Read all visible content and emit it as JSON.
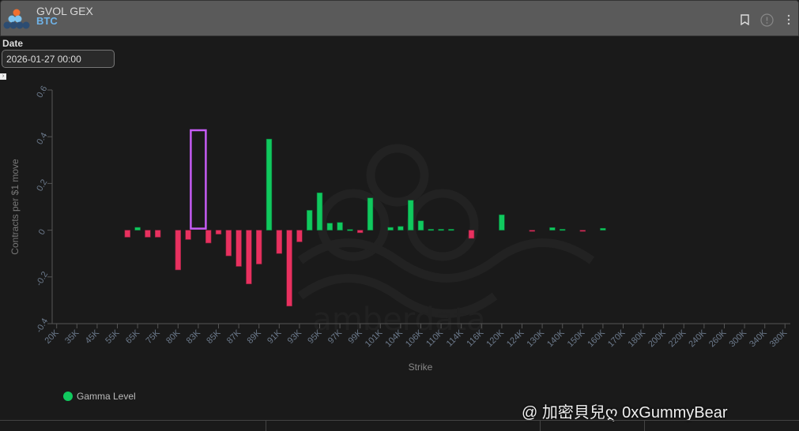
{
  "header": {
    "title": "GVOL GEX",
    "subtitle": "BTC",
    "icons": [
      "bookmark-icon",
      "info-icon",
      "more-vertical-icon"
    ]
  },
  "date_filter": {
    "label": "Date",
    "value": "2026-01-27 00:00"
  },
  "watermark": "amberdata",
  "overlay_text": "@ 加密貝兒ღ 0xGummyBear",
  "colors": {
    "positive": "#10c95e",
    "negative": "#e8315f",
    "highlight": "#c65cf5"
  },
  "chart_data": {
    "type": "bar",
    "xlabel": "Strike",
    "ylabel": "Contracts per $1 move",
    "ylim": [
      -0.4,
      0.6
    ],
    "yticks": [
      "0.6",
      "0.4",
      "0.2",
      "0",
      "-0.2",
      "-0.4"
    ],
    "grid": false,
    "legend": {
      "placement": "bottom-left",
      "entries": [
        "Gamma Level"
      ]
    },
    "categories": [
      "20K",
      "",
      "35K",
      "",
      "45K",
      "",
      "55K",
      "",
      "65K",
      "",
      "75K",
      "",
      "80K",
      "",
      "83K",
      "",
      "85K",
      "",
      "87K",
      "",
      "89K",
      "",
      "91K",
      "",
      "93K",
      "",
      "95K",
      "",
      "97K",
      "",
      "99K",
      "",
      "101K",
      "",
      "104K",
      "",
      "106K",
      "",
      "110K",
      "",
      "114K",
      "",
      "116K",
      "",
      "120K",
      "",
      "124K",
      "",
      "130K",
      "",
      "140K",
      "",
      "150K",
      "",
      "160K",
      "",
      "170K",
      "",
      "180K",
      "",
      "200K",
      "",
      "220K",
      "",
      "240K",
      "",
      "260K",
      "",
      "300K",
      "",
      "340K",
      "",
      "380K"
    ],
    "values": [
      null,
      null,
      null,
      null,
      null,
      null,
      null,
      -0.03,
      0.012,
      -0.03,
      -0.03,
      null,
      -0.17,
      -0.04,
      null,
      -0.055,
      -0.017,
      -0.11,
      -0.155,
      -0.23,
      -0.145,
      0.39,
      -0.1,
      -0.325,
      -0.05,
      0.085,
      0.16,
      0.03,
      0.033,
      0.003,
      -0.011,
      0.138,
      null,
      0.012,
      0.016,
      0.128,
      0.04,
      0.004,
      0.004,
      0.004,
      null,
      -0.035,
      null,
      null,
      0.066,
      null,
      null,
      -0.005,
      null,
      0.011,
      0.004,
      null,
      -0.005,
      null,
      0.008,
      null,
      null,
      null,
      null,
      null,
      null,
      null,
      null,
      null,
      null,
      null,
      null,
      null,
      null,
      null,
      null,
      null,
      null
    ],
    "highlighted_category": "83K"
  }
}
